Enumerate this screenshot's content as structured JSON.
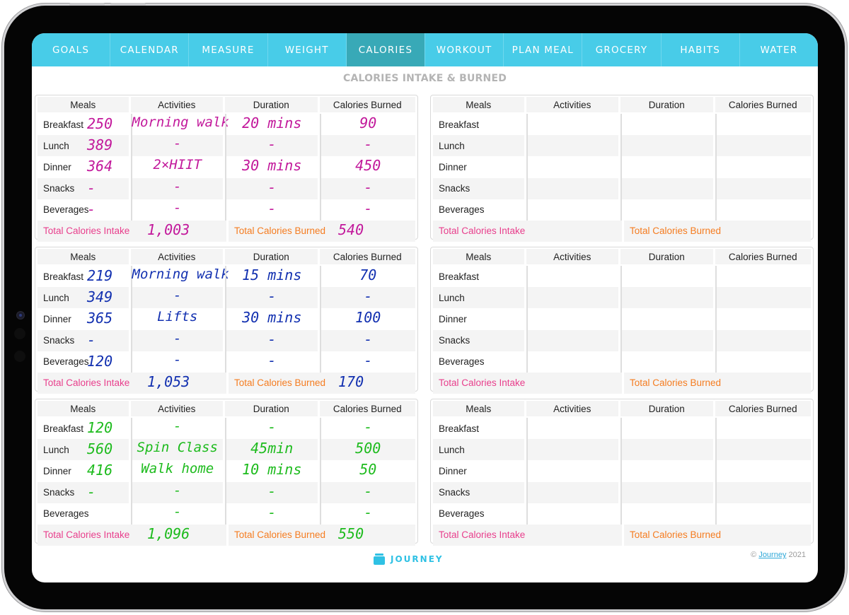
{
  "tabs": [
    {
      "label": "GOALS",
      "active": false
    },
    {
      "label": "CALENDAR",
      "active": false
    },
    {
      "label": "MEASURE",
      "active": false
    },
    {
      "label": "WEIGHT",
      "active": false
    },
    {
      "label": "CALORIES",
      "active": true
    },
    {
      "label": "WORKOUT",
      "active": false
    },
    {
      "label": "PLAN MEAL",
      "active": false
    },
    {
      "label": "GROCERY",
      "active": false
    },
    {
      "label": "HABITS",
      "active": false
    },
    {
      "label": "WATER",
      "active": false
    }
  ],
  "page_title": "CALORIES INTAKE & BURNED",
  "columns": [
    "Meals",
    "Activities",
    "Duration",
    "Calories Burned"
  ],
  "meal_labels": [
    "Breakfast",
    "Lunch",
    "Dinner",
    "Snacks",
    "Beverages"
  ],
  "total_intake_label": "Total Calories Intake",
  "total_burned_label": "Total Calories Burned",
  "colors": {
    "tab_bg": "#48cce8",
    "tab_active_bg": "#38a9b7",
    "intake_label": "#e83e8c",
    "burned_label": "#f57c20",
    "ink_magenta": "#c2189b",
    "ink_blue": "#1230b0",
    "ink_green": "#1dbb1d"
  },
  "blocks": [
    {
      "ink": "magenta",
      "rows": [
        {
          "meal_cal": "250",
          "activity": "Morning walk",
          "duration": "20 mins",
          "burned": "90"
        },
        {
          "meal_cal": "389",
          "activity": "-",
          "duration": "-",
          "burned": "-"
        },
        {
          "meal_cal": "364",
          "activity": "2×HIIT",
          "duration": "30 mins",
          "burned": "450"
        },
        {
          "meal_cal": "-",
          "activity": "-",
          "duration": "-",
          "burned": "-"
        },
        {
          "meal_cal": "-",
          "activity": "-",
          "duration": "-",
          "burned": "-"
        }
      ],
      "total_intake": "1,003",
      "total_burned": "540"
    },
    {
      "ink": "blue",
      "rows": [
        {
          "meal_cal": "219",
          "activity": "Morning walk",
          "duration": "15 mins",
          "burned": "70"
        },
        {
          "meal_cal": "349",
          "activity": "-",
          "duration": "-",
          "burned": "-"
        },
        {
          "meal_cal": "365",
          "activity": "Lifts",
          "duration": "30 mins",
          "burned": "100"
        },
        {
          "meal_cal": "-",
          "activity": "-",
          "duration": "-",
          "burned": "-"
        },
        {
          "meal_cal": "120",
          "activity": "-",
          "duration": "-",
          "burned": "-"
        }
      ],
      "total_intake": "1,053",
      "total_burned": "170"
    },
    {
      "ink": "green",
      "rows": [
        {
          "meal_cal": "120",
          "activity": "-",
          "duration": "-",
          "burned": "-"
        },
        {
          "meal_cal": "560",
          "activity": "Spin Class",
          "duration": "45min",
          "burned": "500"
        },
        {
          "meal_cal": "416",
          "activity": "Walk home",
          "duration": "10 mins",
          "burned": "50"
        },
        {
          "meal_cal": "-",
          "activity": "-",
          "duration": "-",
          "burned": "-"
        },
        {
          "meal_cal": "",
          "activity": "-",
          "duration": "-",
          "burned": "-"
        }
      ],
      "total_intake": "1,096",
      "total_burned": "550"
    },
    {
      "ink": "none",
      "rows": [
        {},
        {},
        {},
        {},
        {}
      ],
      "total_intake": "",
      "total_burned": ""
    },
    {
      "ink": "none",
      "rows": [
        {},
        {},
        {},
        {},
        {}
      ],
      "total_intake": "",
      "total_burned": ""
    },
    {
      "ink": "none",
      "rows": [
        {},
        {},
        {},
        {},
        {}
      ],
      "total_intake": "",
      "total_burned": ""
    }
  ],
  "footer": {
    "logo_text": "JOURNEY",
    "copyright_symbol": "©",
    "copyright_link": "Journey",
    "copyright_year": "2021"
  }
}
